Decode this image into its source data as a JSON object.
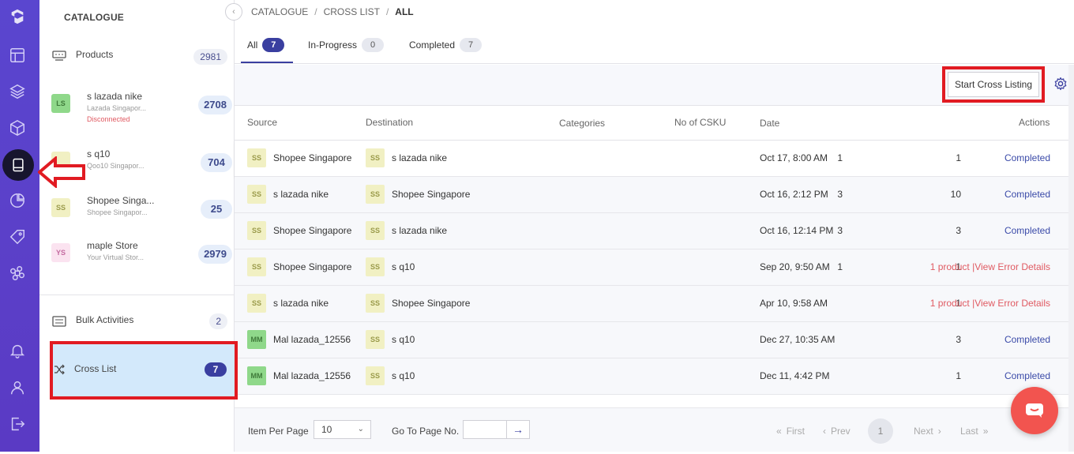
{
  "sidebar_panel": {
    "title": "CATALOGUE",
    "products": {
      "label": "Products",
      "count": "2981"
    },
    "stores": [
      {
        "badge": "LS",
        "name": "s lazada nike",
        "sub": "Lazada Singapor...",
        "status": "Disconnected",
        "count": "2708",
        "badge_bg": "#8fd88a",
        "badge_fg": "#3f7a3a"
      },
      {
        "badge": "",
        "name": "s q10",
        "sub": "Qoo10 Singapor...",
        "status": "",
        "count": "704",
        "badge_bg": "#f1f0c3",
        "badge_fg": "#9a9a4a"
      },
      {
        "badge": "SS",
        "name": "Shopee Singa...",
        "sub": "Shopee Singapor...",
        "status": "",
        "count": "25",
        "badge_bg": "#f1f0c3",
        "badge_fg": "#9a9a4a"
      },
      {
        "badge": "YS",
        "name": "maple Store",
        "sub": "Your Virtual Stor...",
        "status": "",
        "count": "2979",
        "badge_bg": "#fbe3f0",
        "badge_fg": "#c46aa0"
      }
    ],
    "bulk": {
      "label": "Bulk Activities",
      "count": "2"
    },
    "cross": {
      "label": "Cross List",
      "count": "7"
    }
  },
  "breadcrumb": [
    "CATALOGUE",
    "CROSS LIST",
    "ALL"
  ],
  "tabs": [
    {
      "label": "All",
      "count": "7"
    },
    {
      "label": "In-Progress",
      "count": "0"
    },
    {
      "label": "Completed",
      "count": "7"
    }
  ],
  "toolbar": {
    "start_label": "Start Cross Listing"
  },
  "table": {
    "columns": [
      "Source",
      "Destination",
      "Categories",
      "No of CSKU",
      "Date",
      "Actions"
    ],
    "rows": [
      {
        "src_badge": "SS",
        "src": "Shopee Singapore",
        "dst_badge": "SS",
        "dst": "s lazada nike",
        "cat": "1",
        "csku": "1",
        "date": "Oct 17, 8:00 AM",
        "action": "Completed",
        "err_count": "",
        "err_link": ""
      },
      {
        "src_badge": "SS",
        "src": "s lazada nike",
        "dst_badge": "SS",
        "dst": "Shopee Singapore",
        "cat": "3",
        "csku": "10",
        "date": "Oct 16, 2:12 PM",
        "action": "Completed",
        "err_count": "",
        "err_link": ""
      },
      {
        "src_badge": "SS",
        "src": "Shopee Singapore",
        "dst_badge": "SS",
        "dst": "s lazada nike",
        "cat": "3",
        "csku": "3",
        "date": "Oct 16, 12:14 PM",
        "action": "Completed",
        "err_count": "",
        "err_link": ""
      },
      {
        "src_badge": "SS",
        "src": "Shopee Singapore",
        "dst_badge": "SS",
        "dst": "s q10",
        "cat": "1",
        "csku": "1",
        "date": "Sep 20, 9:50 AM",
        "action": "",
        "err_count": "1 product",
        "err_link": "View Error Details"
      },
      {
        "src_badge": "SS",
        "src": "s lazada nike",
        "dst_badge": "SS",
        "dst": "Shopee Singapore",
        "cat": "",
        "csku": "1",
        "date": "Apr 10, 9:58 AM",
        "action": "",
        "err_count": "1 product",
        "err_link": "View Error Details"
      },
      {
        "src_badge": "MM",
        "src": "Mal lazada_12556",
        "dst_badge": "SS",
        "dst": "s q10",
        "cat": "",
        "csku": "3",
        "date": "Dec 27, 10:35 AM",
        "action": "Completed",
        "err_count": "",
        "err_link": ""
      },
      {
        "src_badge": "MM",
        "src": "Mal lazada_12556",
        "dst_badge": "SS",
        "dst": "s q10",
        "cat": "",
        "csku": "1",
        "date": "Dec 11, 4:42 PM",
        "action": "Completed",
        "err_count": "",
        "err_link": ""
      }
    ]
  },
  "footer": {
    "per_page_label": "Item Per Page",
    "per_page_value": "10",
    "goto_label": "Go To Page No.",
    "first": "First",
    "prev": "Prev",
    "current": "1",
    "next": "Next",
    "last": "Last"
  },
  "colors": {
    "accent": "#3a3fa0",
    "rail": "#5a46cf",
    "error": "#e05a62",
    "annotation": "#e11b22",
    "chat": "#f2544f"
  }
}
